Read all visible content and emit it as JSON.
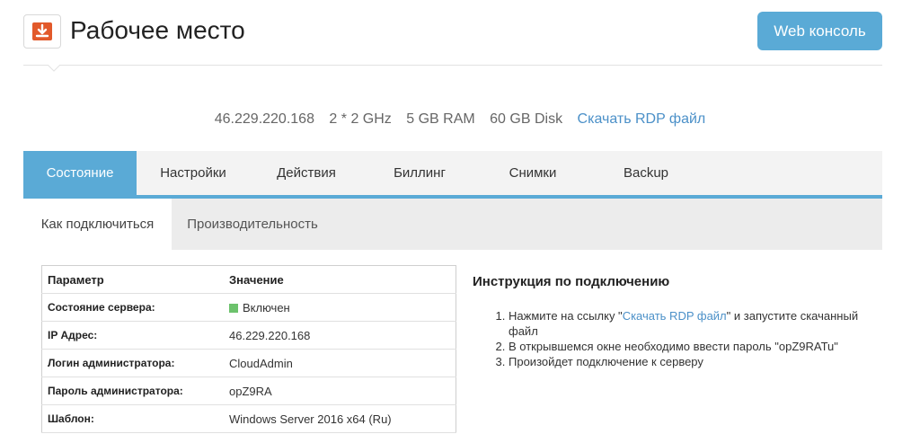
{
  "header": {
    "title": "Рабочее место",
    "logo_icon": "download-icon",
    "logo_color": "#e2592a",
    "web_console_label": "Web консоль",
    "accent_color": "#5aaad6"
  },
  "server_info": {
    "ip": "46.229.220.168",
    "cpu": "2 * 2 GHz",
    "ram": "5 GB RAM",
    "disk": "60 GB Disk",
    "rdp_link": "Скачать RDP файл"
  },
  "tabs": [
    {
      "label": "Состояние",
      "active": true
    },
    {
      "label": "Настройки",
      "active": false
    },
    {
      "label": "Действия",
      "active": false
    },
    {
      "label": "Биллинг",
      "active": false
    },
    {
      "label": "Снимки",
      "active": false
    },
    {
      "label": "Backup",
      "active": false
    }
  ],
  "subtabs": [
    {
      "label": "Как подключиться",
      "active": true
    },
    {
      "label": "Производительность",
      "active": false
    }
  ],
  "params_table": {
    "headers": [
      "Параметр",
      "Значение"
    ],
    "rows": [
      {
        "name": "Состояние сервера:",
        "value": "Включен"
      },
      {
        "name": "IP Адрес:",
        "value": "46.229.220.168"
      },
      {
        "name": "Логин администратора:",
        "value": "CloudAdmin"
      },
      {
        "name": "Пароль администратора:",
        "value": "opZ9RA"
      },
      {
        "name": "Шаблон:",
        "value": "Windows Server 2016 x64 (Ru)"
      }
    ],
    "status_color": "#6cc26c"
  },
  "instructions": {
    "title": "Инструкция по подключению",
    "step1_before": "Нажмите на ссылку \"",
    "step1_link": "Скачать RDP файл",
    "step1_after": "\" и запустите скачанный файл",
    "step2": "В открывшемся окне необходимо ввести пароль \"opZ9RATu\"",
    "step3": "Произойдет подключение к серверу"
  }
}
